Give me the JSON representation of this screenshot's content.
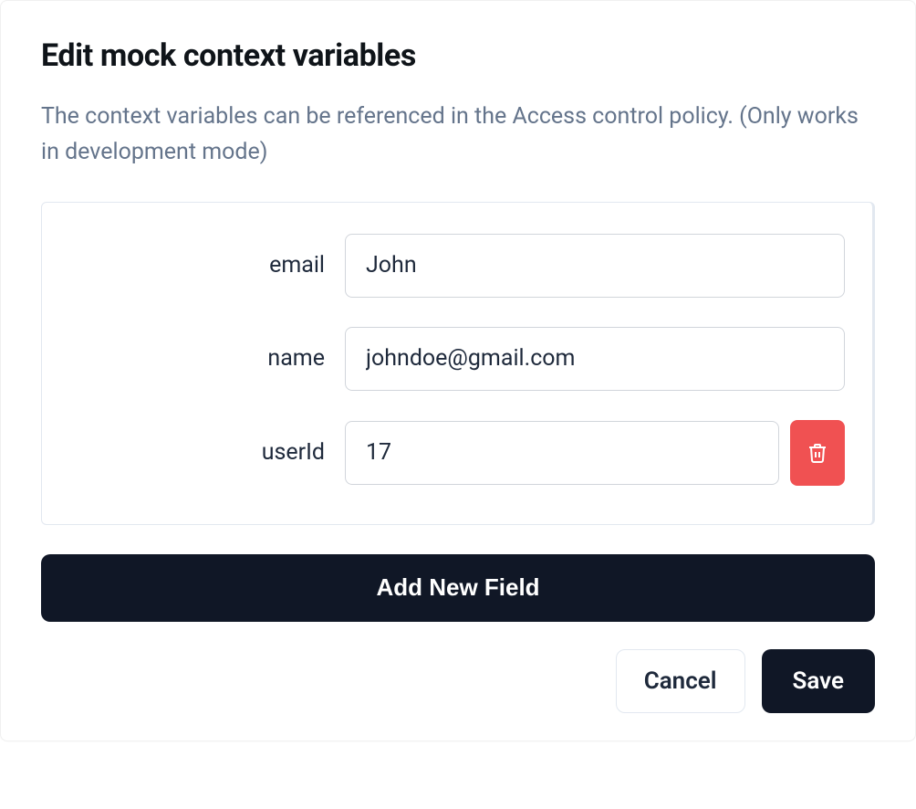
{
  "dialog": {
    "title": "Edit mock context variables",
    "subtitle": "The context variables can be referenced in the Access control policy. (Only works in development mode)",
    "fields": [
      {
        "label": "email",
        "value": "John",
        "deletable": false
      },
      {
        "label": "name",
        "value": "johndoe@gmail.com",
        "deletable": false
      },
      {
        "label": "userId",
        "value": "17",
        "deletable": true
      }
    ],
    "add_field_label": "Add New Field",
    "cancel_label": "Cancel",
    "save_label": "Save"
  }
}
